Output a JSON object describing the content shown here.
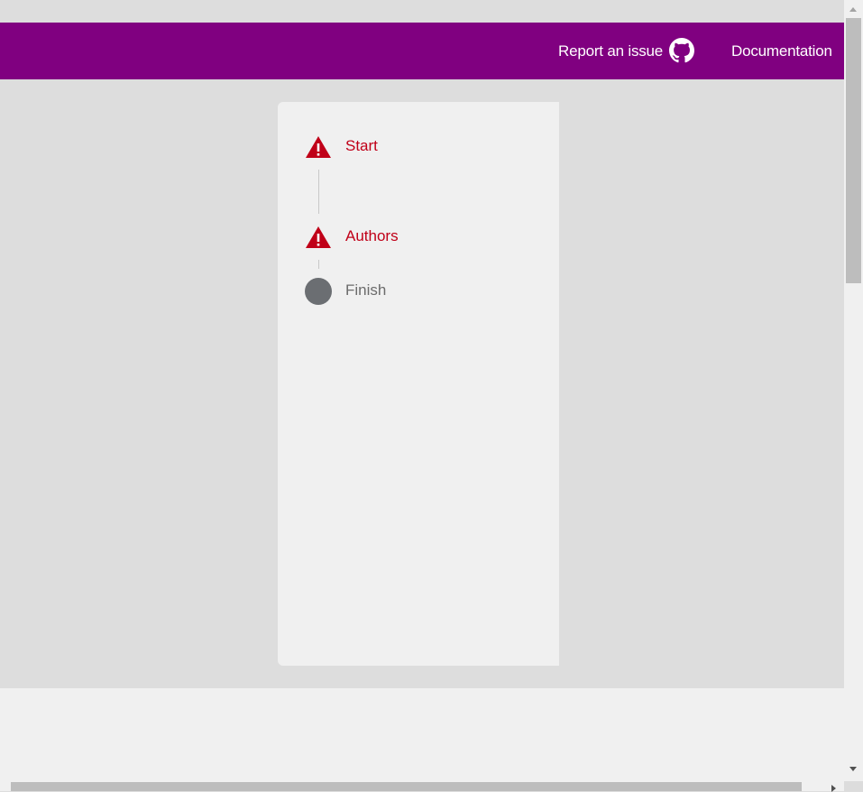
{
  "header": {
    "report_label": "Report an issue",
    "github_icon": "github-icon",
    "docs_label": "Documentation",
    "color": "#800080"
  },
  "stepper": {
    "steps": [
      {
        "label": "Start",
        "state": "error",
        "icon": "warning-icon"
      },
      {
        "label": "Authors",
        "state": "error",
        "icon": "warning-icon"
      },
      {
        "label": "Finish",
        "state": "pending",
        "icon": "circle-icon"
      }
    ],
    "error_color": "#c00018",
    "pending_color": "#6b6b6b"
  }
}
